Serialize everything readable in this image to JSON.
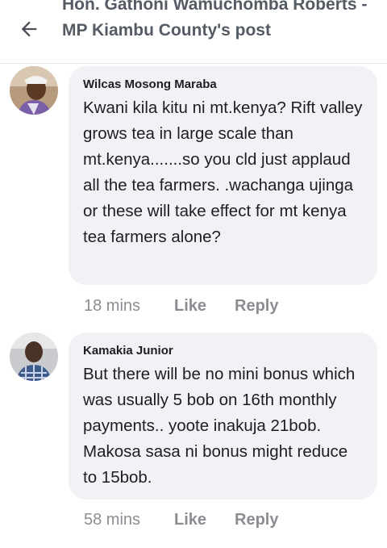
{
  "header": {
    "back_icon": "arrow-left-icon",
    "title": "Hon. Gathoni Wamuchomba Roberts - MP Kiambu County's post"
  },
  "comments": [
    {
      "author": "Wilcas Mosong Maraba",
      "text": "Kwani kila kitu ni mt.kenya? Rift valley grows tea in large scale than mt.kenya.......so you cld just applaud all the tea farmers. .wachanga ujinga or these will take effect for mt kenya tea farmers alone?",
      "time": "18 mins",
      "like_label": "Like",
      "reply_label": "Reply"
    },
    {
      "author": "Kamakia Junior",
      "text": "But there will be no mini bonus which was usually 5 bob on 16th monthly payments.. yoote inakuja 21bob. Makosa sasa ni bonus might reduce to 15bob.",
      "time": "58 mins",
      "like_label": "Like",
      "reply_label": "Reply"
    }
  ],
  "colors": {
    "bubble_bg": "#f0f2f5",
    "meta_text": "#8a8d91",
    "header_text": "#555b64"
  }
}
